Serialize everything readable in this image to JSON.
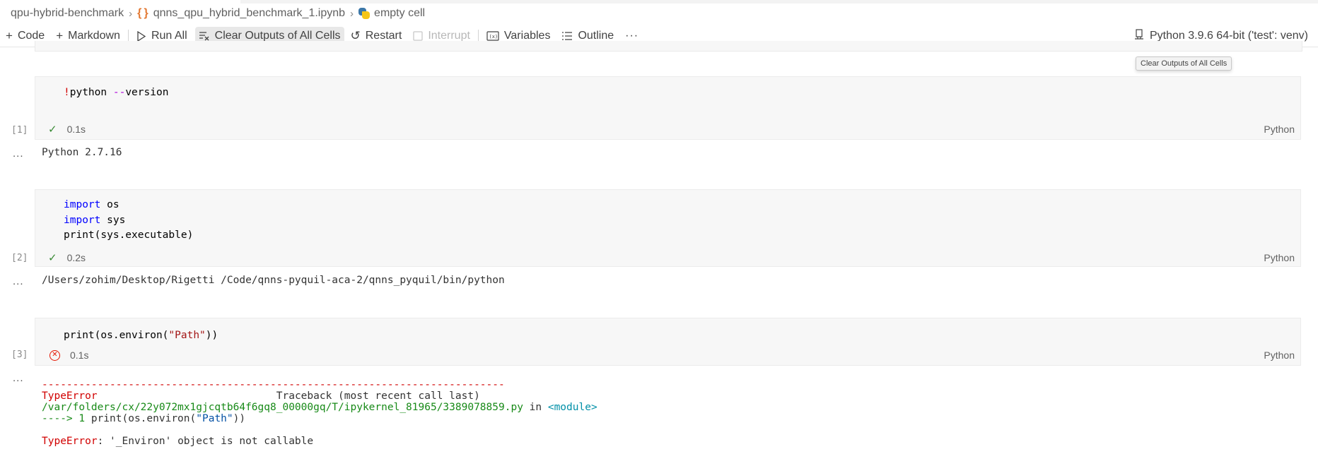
{
  "breadcrumb": {
    "folder": "qpu-hybrid-benchmark",
    "notebook": "qnns_qpu_hybrid_benchmark_1.ipynb",
    "cell": "empty cell"
  },
  "toolbar": {
    "code": "Code",
    "markdown": "Markdown",
    "run_all": "Run All",
    "clear_outputs": "Clear Outputs of All Cells",
    "restart": "Restart",
    "interrupt": "Interrupt",
    "variables": "Variables",
    "outline": "Outline",
    "more": "···",
    "kernel": "Python 3.9.6 64-bit ('test': venv)"
  },
  "tooltip": "Clear Outputs of All Cells",
  "cells": [
    {
      "exec": "[1]",
      "code_parts": [
        "!",
        "python ",
        "--",
        "version"
      ],
      "status": "succeeded",
      "time": "0.1s",
      "lang": "Python",
      "output": "Python 2.7.16"
    },
    {
      "exec": "[2]",
      "code_lines": [
        [
          "import",
          " os"
        ],
        [
          "import",
          " sys"
        ],
        [
          "",
          "print(sys.executable)"
        ]
      ],
      "status": "succeeded",
      "time": "0.2s",
      "lang": "Python",
      "output": "/Users/zohim/Desktop/Rigetti /Code/qnns-pyquil-aca-2/qnns_pyquil/bin/python"
    },
    {
      "exec": "[3]",
      "code_parts": [
        "print(os.environ(",
        "\"Path\"",
        "))"
      ],
      "status": "failed",
      "time": "0.1s",
      "lang": "Python",
      "traceback": {
        "dashes": "---------------------------------------------------------------------------",
        "error_name": "TypeError",
        "traceback_header": "Traceback (most recent call last)",
        "file": "/var/folders/cx/22y072mx1gjcqtb64f6gq8_00000gq/T/ipykernel_81965/3389078859.py",
        "in_word": " in ",
        "module": "<module>",
        "arrow": "----> 1 ",
        "line_code_a": "print(os.environ(",
        "line_code_str": "\"Path\"",
        "line_code_b": "))",
        "final_error": "TypeError",
        "final_message": ": '_Environ' object is not callable"
      }
    }
  ],
  "output_dots": "..."
}
